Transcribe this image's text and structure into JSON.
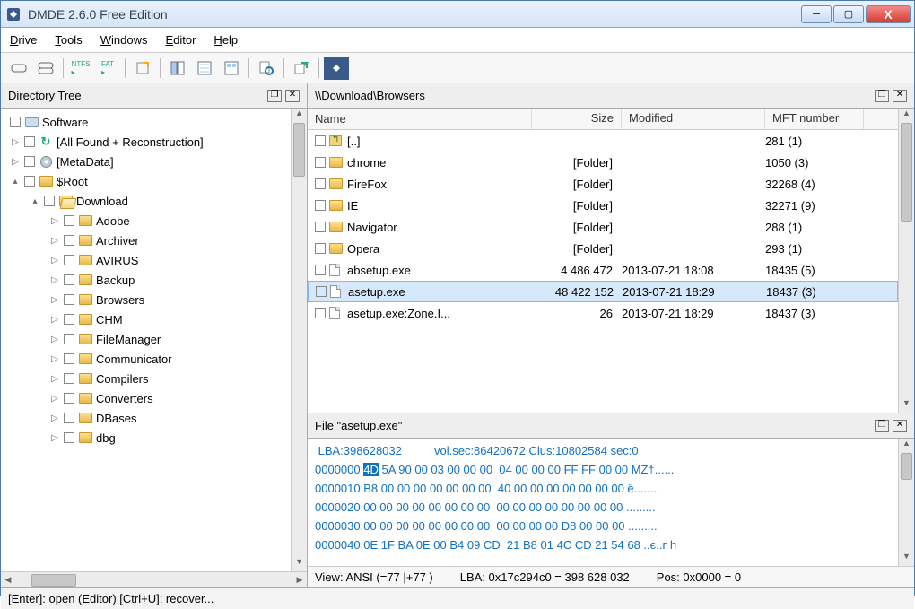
{
  "window": {
    "title": "DMDE 2.6.0 Free Edition"
  },
  "menu": [
    "Drive",
    "Tools",
    "Windows",
    "Editor",
    "Help"
  ],
  "panels": {
    "tree_title": "Directory Tree",
    "path_title": "\\\\Download\\Browsers",
    "hex_title": "File \"asetup.exe\""
  },
  "tree": {
    "root": "Software",
    "items": [
      {
        "indent": 0,
        "exp": "▷",
        "icon": "refresh",
        "label": "[All Found + Reconstruction]"
      },
      {
        "indent": 0,
        "exp": "▷",
        "icon": "disc",
        "label": "[MetaData]"
      },
      {
        "indent": 0,
        "exp": "▴",
        "icon": "folder",
        "label": "$Root"
      },
      {
        "indent": 1,
        "exp": "▴",
        "icon": "folder-open",
        "label": "Download"
      },
      {
        "indent": 2,
        "exp": "▷",
        "icon": "folder",
        "label": "Adobe"
      },
      {
        "indent": 2,
        "exp": "▷",
        "icon": "folder",
        "label": "Archiver"
      },
      {
        "indent": 2,
        "exp": "▷",
        "icon": "folder",
        "label": "AVIRUS"
      },
      {
        "indent": 2,
        "exp": "▷",
        "icon": "folder",
        "label": "Backup"
      },
      {
        "indent": 2,
        "exp": "▷",
        "icon": "folder",
        "label": "Browsers"
      },
      {
        "indent": 2,
        "exp": "▷",
        "icon": "folder",
        "label": "CHM"
      },
      {
        "indent": 2,
        "exp": "▷",
        "icon": "folder",
        "label": "FileManager"
      },
      {
        "indent": 2,
        "exp": "▷",
        "icon": "folder",
        "label": "Communicator"
      },
      {
        "indent": 2,
        "exp": "▷",
        "icon": "folder",
        "label": "Compilers"
      },
      {
        "indent": 2,
        "exp": "▷",
        "icon": "folder",
        "label": "Converters"
      },
      {
        "indent": 2,
        "exp": "▷",
        "icon": "folder",
        "label": "DBases"
      },
      {
        "indent": 2,
        "exp": "▷",
        "icon": "folder",
        "label": "dbg"
      }
    ]
  },
  "filelist": {
    "headers": {
      "name": "Name",
      "size": "Size",
      "modified": "Modified",
      "mft": "MFT number"
    },
    "rows": [
      {
        "icon": "up",
        "name": "[..]",
        "size": "",
        "mod": "",
        "mft": "281 (1)",
        "sel": false
      },
      {
        "icon": "folder",
        "name": "chrome",
        "size": "[Folder]",
        "mod": "",
        "mft": "1050 (3)",
        "sel": false
      },
      {
        "icon": "folder",
        "name": "FireFox",
        "size": "[Folder]",
        "mod": "",
        "mft": "32268 (4)",
        "sel": false
      },
      {
        "icon": "folder",
        "name": "IE",
        "size": "[Folder]",
        "mod": "",
        "mft": "32271 (9)",
        "sel": false
      },
      {
        "icon": "folder",
        "name": "Navigator",
        "size": "[Folder]",
        "mod": "",
        "mft": "288 (1)",
        "sel": false
      },
      {
        "icon": "folder",
        "name": "Opera",
        "size": "[Folder]",
        "mod": "",
        "mft": "293 (1)",
        "sel": false
      },
      {
        "icon": "file",
        "name": "absetup.exe",
        "size": "4 486 472",
        "mod": "2013-07-21 18:08",
        "mft": "18435 (5)",
        "sel": false
      },
      {
        "icon": "file",
        "name": "asetup.exe",
        "size": "48 422 152",
        "mod": "2013-07-21 18:29",
        "mft": "18437 (3)",
        "sel": true
      },
      {
        "icon": "file",
        "name": "asetup.exe:Zone.I...",
        "size": "26",
        "mod": "2013-07-21 18:29",
        "mft": "18437 (3)",
        "sel": false
      }
    ]
  },
  "hex": {
    "info": " LBA:398628032          vol.sec:86420672 Clus:10802584 sec:0",
    "lines": [
      {
        "addr": "0000000:",
        "b1": "4D",
        "rest": " 5A 90 00 03 00 00 00  04 00 00 00 FF FF 00 00 MZ†......"
      },
      {
        "addr": "0000010:",
        "b1": "",
        "rest": "B8 00 00 00 00 00 00 00  40 00 00 00 00 00 00 00 ё........"
      },
      {
        "addr": "0000020:",
        "b1": "",
        "rest": "00 00 00 00 00 00 00 00  00 00 00 00 00 00 00 00 ........."
      },
      {
        "addr": "0000030:",
        "b1": "",
        "rest": "00 00 00 00 00 00 00 00  00 00 00 00 D8 00 00 00 ........."
      },
      {
        "addr": "0000040:",
        "b1": "",
        "rest": "0E 1F BA 0E 00 B4 09 CD  21 B8 01 4C CD 21 54 68 ..є..г һ"
      }
    ],
    "status": {
      "view": "View: ANSI (=77 |+77 )",
      "lba": "LBA: 0x17c294c0 = 398 628 032",
      "pos": "Pos: 0x0000 = 0"
    }
  },
  "statusbar": "[Enter]: open (Editor)  [Ctrl+U]: recover..."
}
